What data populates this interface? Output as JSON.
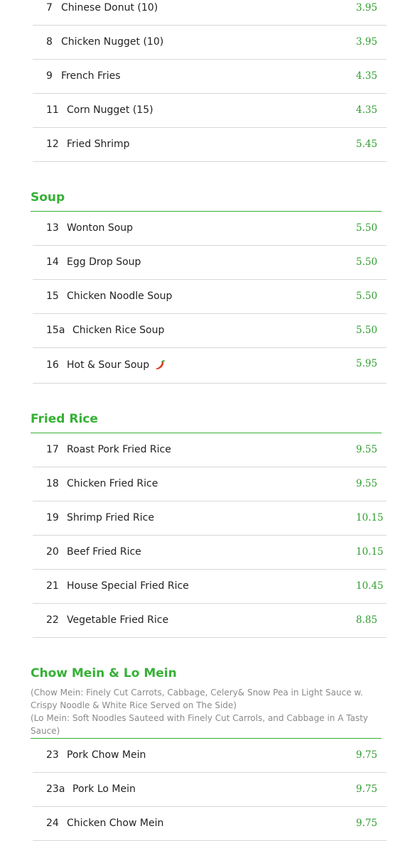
{
  "appetizers": {
    "items": [
      {
        "num": "7",
        "name": "Chinese Donut (10)",
        "price": "3.95"
      },
      {
        "num": "8",
        "name": "Chicken Nugget (10)",
        "price": "3.95"
      },
      {
        "num": "9",
        "name": "French Fries",
        "price": "4.35"
      },
      {
        "num": "11",
        "name": "Corn Nugget (15)",
        "price": "4.35"
      },
      {
        "num": "12",
        "name": "Fried Shrimp",
        "price": "5.45"
      }
    ]
  },
  "soup": {
    "title": "Soup",
    "items": [
      {
        "num": "13",
        "name": "Wonton Soup",
        "price": "5.50"
      },
      {
        "num": "14",
        "name": "Egg Drop Soup",
        "price": "5.50"
      },
      {
        "num": "15",
        "name": "Chicken Noodle Soup",
        "price": "5.50"
      },
      {
        "num": "15a",
        "name": "Chicken Rice Soup",
        "price": "5.50"
      },
      {
        "num": "16",
        "name": "Hot & Sour Soup",
        "price": "5.95",
        "icon": "chili-pepper-icon"
      }
    ]
  },
  "fried_rice": {
    "title": "Fried Rice",
    "items": [
      {
        "num": "17",
        "name": "Roast Pork Fried Rice",
        "price": "9.55"
      },
      {
        "num": "18",
        "name": "Chicken Fried Rice",
        "price": "9.55"
      },
      {
        "num": "19",
        "name": "Shrimp Fried Rice",
        "price": "10.15"
      },
      {
        "num": "20",
        "name": "Beef Fried Rice",
        "price": "10.15"
      },
      {
        "num": "21",
        "name": "House Special Fried Rice",
        "price": "10.45"
      },
      {
        "num": "22",
        "name": "Vegetable Fried Rice",
        "price": "8.85"
      }
    ]
  },
  "chow_mein": {
    "title": "Chow Mein & Lo Mein",
    "note_1": "(Chow Mein: Finely Cut Carrots, Cabbage, Celery& Snow Pea in Light Sauce w. Crispy Noodle & White Rice Served on The Side)",
    "note_2": "(Lo Mein: Soft Noodles Sauteed with Finely Cut Carrols, and Cabbage in A Tasty Sauce)",
    "items": [
      {
        "num": "23",
        "name": "Pork Chow Mein",
        "price": "9.75"
      },
      {
        "num": "23a",
        "name": "Pork Lo Mein",
        "price": "9.75"
      },
      {
        "num": "24",
        "name": "Chicken Chow Mein",
        "price": "9.75"
      }
    ]
  },
  "colors": {
    "accent": "#35b135",
    "price": "#2e9e2e",
    "divider": "#d8d8d8",
    "note": "#8a8a8a"
  }
}
